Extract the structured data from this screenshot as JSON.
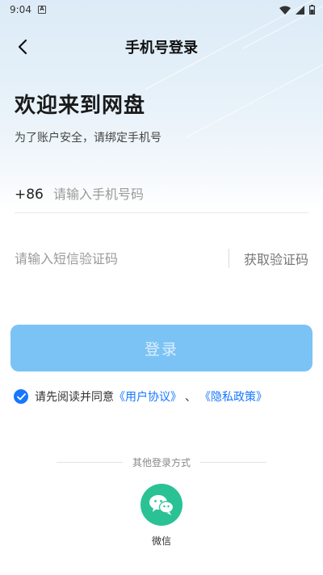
{
  "status_bar": {
    "time": "9:04",
    "notification_icon": "a-icon",
    "wifi_icon": "wifi-icon",
    "signal_icon": "signal-icon",
    "battery_icon": "battery-icon"
  },
  "nav": {
    "back_icon": "chevron-left-icon",
    "title": "手机号登录"
  },
  "header": {
    "welcome": "欢迎来到网盘",
    "subtitle": "为了账户安全，请绑定手机号"
  },
  "form": {
    "country_code": "+86",
    "phone_placeholder": "请输入手机号码",
    "phone_value": "",
    "code_placeholder": "请输入短信验证码",
    "code_value": "",
    "get_code_label": "获取验证码",
    "login_label": "登录"
  },
  "agreement": {
    "checked": true,
    "prefix": "请先阅读并同意",
    "user_agreement": "《用户协议》",
    "separator": "、",
    "privacy_policy": "《隐私政策》"
  },
  "other_login": {
    "label": "其他登录方式",
    "wechat_label": "微信",
    "wechat_icon": "wechat-icon"
  },
  "colors": {
    "accent": "#1677ff",
    "login_button": "#7cc3f5",
    "wechat": "#2ac295"
  }
}
